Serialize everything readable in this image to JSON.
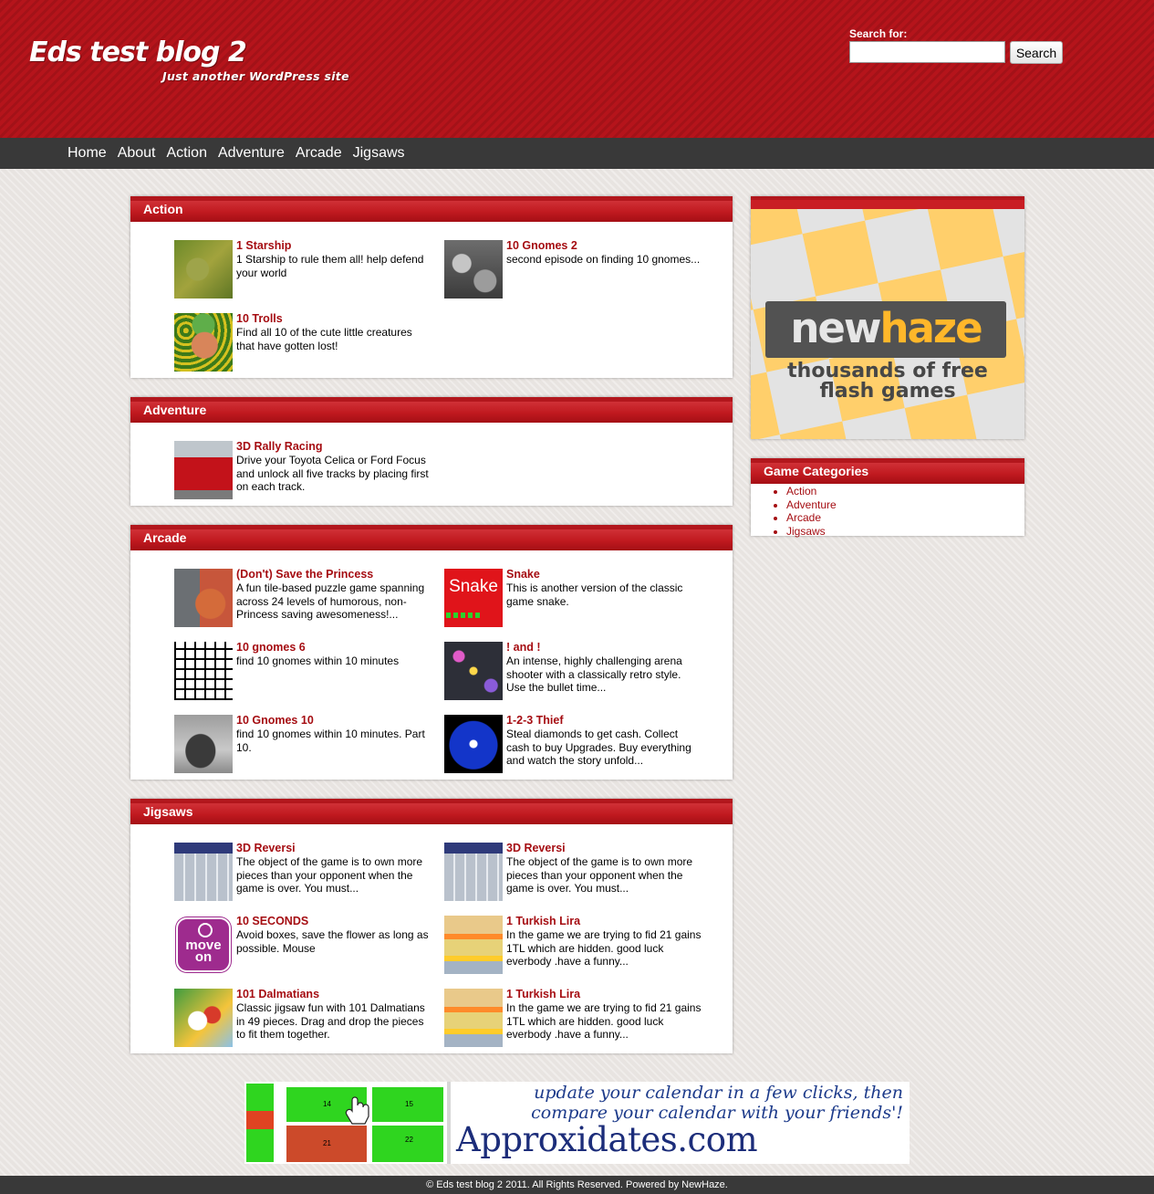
{
  "site": {
    "title": "Eds test blog 2",
    "tagline": "Just another WordPress site"
  },
  "search": {
    "label": "Search for:",
    "value": "",
    "button_label": "Search"
  },
  "nav": {
    "items": [
      "Home",
      "About",
      "Action",
      "Adventure",
      "Arcade",
      "Jigsaws"
    ]
  },
  "sections": [
    {
      "title": "Action",
      "games": [
        {
          "title": "1 Starship",
          "desc": "1 Starship to rule them all! help defend your world",
          "thumb": "starship"
        },
        {
          "title": "10 Gnomes 2",
          "desc": "second episode on finding 10 gnomes...",
          "thumb": "gnomes2"
        },
        {
          "title": "10 Trolls",
          "desc": "Find all 10 of the cute little creatures that have gotten lost!",
          "thumb": "trolls"
        }
      ]
    },
    {
      "title": "Adventure",
      "games": [
        {
          "title": "3D Rally Racing",
          "desc": "Drive your Toyota Celica or Ford Focus and unlock all five tracks by placing first on each track.",
          "thumb": "rally"
        }
      ]
    },
    {
      "title": "Arcade",
      "games": [
        {
          "title": "(Don't) Save the Princess",
          "desc": "A fun tile-based puzzle game spanning across 24 levels of humorous, non-Princess saving awesomeness!...",
          "thumb": "princess"
        },
        {
          "title": "Snake",
          "desc": "This is another version of the classic game snake.",
          "thumb": "snake",
          "thumb_text": "Snake"
        },
        {
          "title": "10 gnomes 6",
          "desc": "find 10 gnomes within 10 minutes",
          "thumb": "gnomes6"
        },
        {
          "title": "! and !",
          "desc": "An intense, highly challenging arena shooter with a classically retro style. Use the bullet time...",
          "thumb": "and"
        },
        {
          "title": "10 Gnomes 10",
          "desc": "find 10 gnomes within 10 minutes. Part 10.",
          "thumb": "gnomes10"
        },
        {
          "title": "1-2-3 Thief",
          "desc": "Steal diamonds to get cash. Collect cash to buy Upgrades. Buy everything and watch the story unfold...",
          "thumb": "thief"
        }
      ]
    },
    {
      "title": "Jigsaws",
      "games": [
        {
          "title": "3D Reversi",
          "desc": "The object of the game is to own more pieces than your opponent when the game is over. You must...",
          "thumb": "reversi"
        },
        {
          "title": "3D Reversi",
          "desc": "The object of the game is to own more pieces than your opponent when the game is over. You must...",
          "thumb": "reversi"
        },
        {
          "title": "10 SECONDS",
          "desc": "Avoid boxes, save the flower as long as possible. Mouse",
          "thumb": "seconds",
          "thumb_text": "move on"
        },
        {
          "title": "1 Turkish Lira",
          "desc": "In the game we are trying to fid 21 gains 1TL which are hidden. good luck everbody .have a funny...",
          "thumb": "lira"
        },
        {
          "title": "101 Dalmatians",
          "desc": "Classic jigsaw fun with 101 Dalmatians in 49 pieces. Drag and drop the pieces to fit them together.",
          "thumb": "dalmatians"
        },
        {
          "title": "1 Turkish Lira",
          "desc": "In the game we are trying to fid 21 gains 1TL which are hidden. good luck everbody .have a funny...",
          "thumb": "lira"
        }
      ]
    }
  ],
  "sidebar": {
    "ad": {
      "logo_part1": "new",
      "logo_part2": "haze",
      "tagline_line1": "thousands of free",
      "tagline_line2": "flash games",
      "colors": {
        "accent": "#ffb72a",
        "logo_bg": "#525252"
      }
    },
    "categories": {
      "title": "Game Categories",
      "items": [
        "Action",
        "Adventure",
        "Arcade",
        "Jigsaws"
      ]
    }
  },
  "banner": {
    "line1": "update your calendar in a few clicks, then",
    "line2": "compare your calendar with your friends'!",
    "brand": "Approxidates.com",
    "calendar_cells": [
      "14",
      "15",
      "21",
      "22"
    ]
  },
  "footer": {
    "text": "© Eds test blog 2 2011. All Rights Reserved. Powered by NewHaze."
  },
  "colors": {
    "brand_red": "#b5141b",
    "link": "#a50d12",
    "nav_bg": "#393939"
  }
}
